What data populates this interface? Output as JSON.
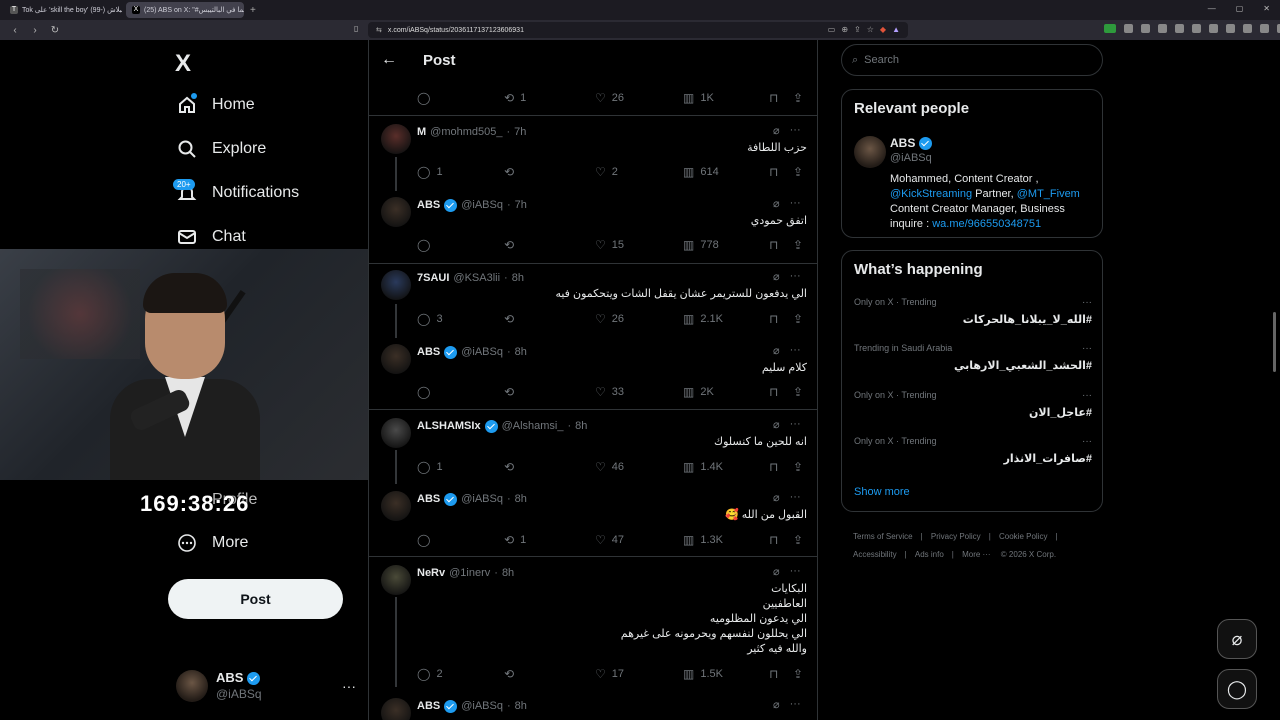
{
  "browser": {
    "tabs": [
      {
        "title": "Tok على 'skill the boy' إسبلاش (-99)",
        "favicon": "T"
      },
      {
        "title": "(25) ABS on X: \"#ميما في البالتيبس",
        "favicon": "X"
      }
    ],
    "url": "x.com/iABSq/status/2036117137123606931"
  },
  "nav": {
    "logo": "X",
    "items": [
      {
        "label": "Home",
        "icon": "home-icon"
      },
      {
        "label": "Explore",
        "icon": "search-icon"
      },
      {
        "label": "Notifications",
        "icon": "bell-icon",
        "badge": "20+"
      },
      {
        "label": "Chat",
        "icon": "mail-icon"
      },
      {
        "label": "Profile",
        "icon": "profile-icon"
      },
      {
        "label": "More",
        "icon": "more-circle-icon"
      }
    ],
    "post_label": "Post",
    "account": {
      "name": "ABS",
      "handle": "@iABSq"
    }
  },
  "overlay": {
    "timer": "169:38:26"
  },
  "main": {
    "header_title": "Post",
    "top_actions": {
      "replies": "",
      "reposts": "1",
      "likes": "26",
      "views": "1K"
    },
    "tweets": [
      {
        "name": "M",
        "handle": "@mohmd505_",
        "time": "7h",
        "text": [
          "حزب اللطافة"
        ],
        "replies": "1",
        "reposts": "",
        "likes": "2",
        "views": "614",
        "verified": false
      },
      {
        "name": "ABS",
        "handle": "@iABSq",
        "time": "7h",
        "text": [
          "اتفق حمودي"
        ],
        "replies": "",
        "reposts": "",
        "likes": "15",
        "views": "778",
        "verified": true
      },
      {
        "name": "7SAUI",
        "handle": "@KSA3lii",
        "time": "8h",
        "text": [
          "الي يدفعون للستريمر عشان يقفل الشات ويتحكمون فيه"
        ],
        "replies": "3",
        "reposts": "",
        "likes": "26",
        "views": "2.1K",
        "verified": false
      },
      {
        "name": "ABS",
        "handle": "@iABSq",
        "time": "8h",
        "text": [
          "كلام سليم"
        ],
        "replies": "",
        "reposts": "",
        "likes": "33",
        "views": "2K",
        "verified": true
      },
      {
        "name": "ALSHAMSIx",
        "handle": "@Alshamsi_",
        "time": "8h",
        "text": [
          "انه للحين ما كنسلوك"
        ],
        "replies": "1",
        "reposts": "",
        "likes": "46",
        "views": "1.4K",
        "verified": true
      },
      {
        "name": "ABS",
        "handle": "@iABSq",
        "time": "8h",
        "text": [
          "القبول من الله 🥰"
        ],
        "replies": "",
        "reposts": "1",
        "likes": "47",
        "views": "1.3K",
        "verified": true
      },
      {
        "name": "NeRv",
        "handle": "@1inerv",
        "time": "8h",
        "text": [
          "البكايات",
          "العاطفيين",
          "الي يدعون المظلوميه",
          "الي يحللون لنفسهم ويحرمونه على غيرهم",
          "والله فيه كثير"
        ],
        "replies": "2",
        "reposts": "",
        "likes": "17",
        "views": "1.5K",
        "verified": false
      },
      {
        "name": "ABS",
        "handle": "@iABSq",
        "time": "8h",
        "text": [],
        "replies": "",
        "reposts": "",
        "likes": "",
        "views": "",
        "verified": true
      }
    ]
  },
  "right": {
    "search_placeholder": "Search",
    "relevant": {
      "title": "Relevant people",
      "name": "ABS",
      "handle": "@iABSq",
      "bio_1": "Mohammed, Content Creator ,",
      "bio_link_1": "@KickStreaming",
      "bio_2": " Partner, ",
      "bio_link_2": "@MT_Fivem",
      "bio_3": "Content Creator Manager, Business inquire : ",
      "bio_link_3": "wa.me/966550348751"
    },
    "happening": {
      "title": "What’s happening",
      "trends": [
        {
          "context": "Only on X · Trending",
          "tag": "#الله_لا_يبلانا_هالحركات"
        },
        {
          "context": "Trending in Saudi Arabia",
          "tag": "#الحشد_الشعبي_الارهابي"
        },
        {
          "context": "Only on X · Trending",
          "tag": "#عاجل_الان"
        },
        {
          "context": "Only on X · Trending",
          "tag": "#صافرات_الانذار"
        }
      ],
      "show_more": "Show more"
    },
    "footer": [
      "Terms of Service",
      "Privacy Policy",
      "Cookie Policy",
      "Accessibility",
      "Ads info",
      "More ···",
      "© 2026 X Corp."
    ]
  },
  "colors": {
    "accent": "#1d9bf0",
    "bg": "#000000",
    "muted": "#71767b"
  }
}
